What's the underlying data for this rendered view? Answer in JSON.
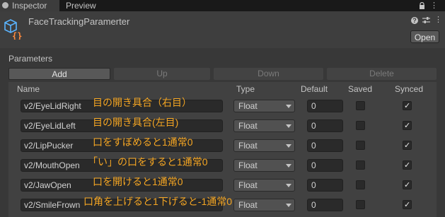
{
  "tabs": [
    {
      "label": "Inspector"
    },
    {
      "label": "Preview"
    }
  ],
  "component": {
    "title": "FaceTrackingParamerter",
    "open_label": "Open"
  },
  "section": {
    "label": "Parameters"
  },
  "toolbar": {
    "add_label": "Add",
    "up_label": "Up",
    "down_label": "Down",
    "delete_label": "Delete"
  },
  "columns": {
    "name": "Name",
    "type": "Type",
    "default": "Default",
    "saved": "Saved",
    "synced": "Synced"
  },
  "rows": [
    {
      "name": "v2/EyeLidRight",
      "type": "Float",
      "default": "0",
      "saved": false,
      "synced": true,
      "note": "目の開き具合（右目）"
    },
    {
      "name": "v2/EyeLidLeft",
      "type": "Float",
      "default": "0",
      "saved": false,
      "synced": true,
      "note": "目の開き具合(左目)"
    },
    {
      "name": "v2/LipPucker",
      "type": "Float",
      "default": "0",
      "saved": false,
      "synced": true,
      "note": "口をすぼめると1通常0"
    },
    {
      "name": "v2/MouthOpen",
      "type": "Float",
      "default": "0",
      "saved": false,
      "synced": true,
      "note": "「い」の口をすると1通常0"
    },
    {
      "name": "v2/JawOpen",
      "type": "Float",
      "default": "0",
      "saved": false,
      "synced": true,
      "note": "口を開けると1通常0"
    },
    {
      "name": "v2/SmileFrown",
      "type": "Float",
      "default": "0",
      "saved": false,
      "synced": true,
      "note": "口角を上げると1下げると-1通常0"
    }
  ],
  "colors": {
    "annotation": "#f5a623",
    "script_icon_blue": "#5ab4ff",
    "script_icon_orange": "#ff8a3d"
  }
}
